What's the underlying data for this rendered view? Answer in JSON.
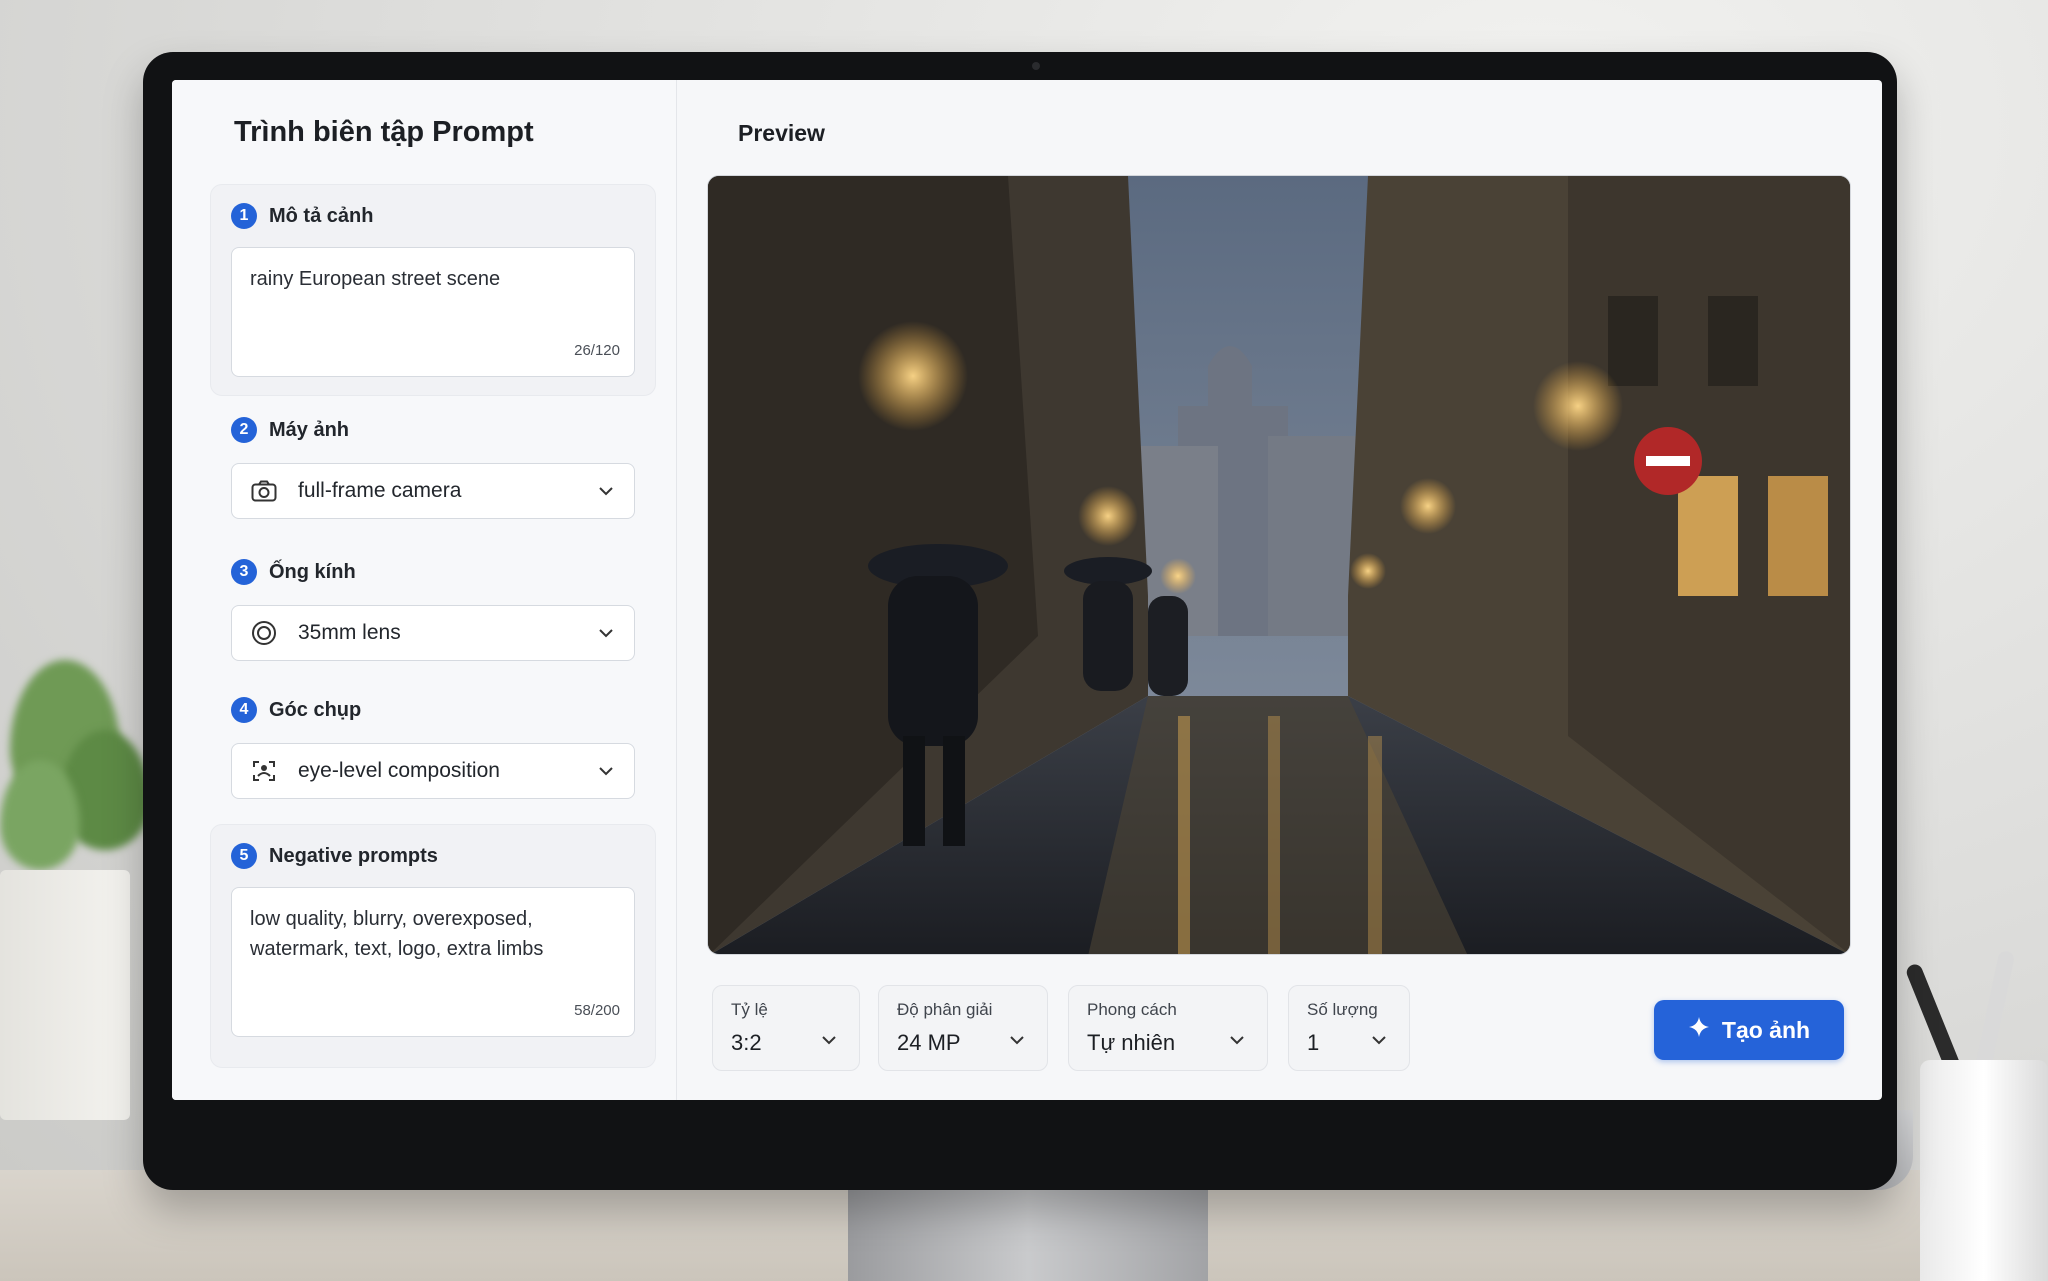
{
  "editor": {
    "title": "Trình biên tập Prompt",
    "sections": [
      {
        "number": "1",
        "label": "Mô tả cảnh",
        "value": "rainy European street scene",
        "count": "26/120"
      },
      {
        "number": "2",
        "label": "Máy ảnh",
        "value": "full-frame camera",
        "icon": "camera-icon"
      },
      {
        "number": "3",
        "label": "Ống kính",
        "value": "35mm lens",
        "icon": "lens-icon"
      },
      {
        "number": "4",
        "label": "Góc chụp",
        "value": "eye-level composition",
        "icon": "framing-icon"
      },
      {
        "number": "5",
        "label": "Negative prompts",
        "value": "low quality, blurry, overexposed, watermark, text, logo, extra limbs",
        "count": "58/200"
      }
    ]
  },
  "preview": {
    "title": "Preview",
    "image_description_icon": "generated-image"
  },
  "controls": {
    "aspect": {
      "label": "Tỷ lệ",
      "value": "3:2"
    },
    "resolution": {
      "label": "Độ phân giải",
      "value": "24 MP"
    },
    "style": {
      "label": "Phong cách",
      "value": "Tự nhiên"
    },
    "quantity": {
      "label": "Số lượng",
      "value": "1"
    },
    "generate": {
      "label": "Tạo ảnh",
      "icon": "sparkle-icon"
    }
  },
  "colors": {
    "accent": "#2563d9",
    "badge": "#2463d8",
    "panel": "#f7f8fa"
  }
}
